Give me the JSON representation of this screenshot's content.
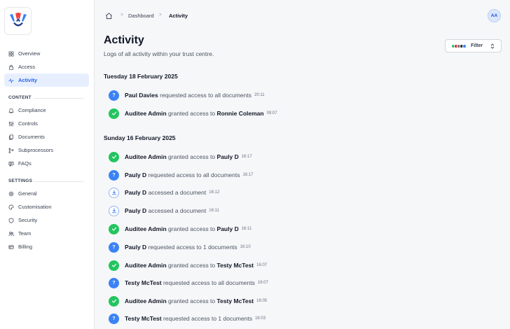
{
  "app": {
    "avatar_initials": "AA"
  },
  "breadcrumb": {
    "items": [
      "Dashboard",
      "Activity"
    ],
    "separator": ">"
  },
  "sidebar": {
    "top_items": [
      {
        "label": "Overview",
        "icon": "grid-icon",
        "active": false
      },
      {
        "label": "Access",
        "icon": "lock-icon",
        "active": false
      },
      {
        "label": "Activity",
        "icon": "pulse-icon",
        "active": true
      }
    ],
    "content_label": "CONTENT",
    "content_items": [
      {
        "label": "Compliance",
        "icon": "bell-icon"
      },
      {
        "label": "Controls",
        "icon": "sliders-icon"
      },
      {
        "label": "Documents",
        "icon": "documents-icon"
      },
      {
        "label": "Subprocessors",
        "icon": "branch-icon"
      },
      {
        "label": "FAQs",
        "icon": "chat-icon"
      }
    ],
    "settings_label": "SETTINGS",
    "settings_items": [
      {
        "label": "General",
        "icon": "gear-icon"
      },
      {
        "label": "Customisation",
        "icon": "palette-icon"
      },
      {
        "label": "Security",
        "icon": "shield-icon"
      },
      {
        "label": "Team",
        "icon": "team-icon"
      },
      {
        "label": "Billing",
        "icon": "card-icon"
      }
    ]
  },
  "page": {
    "title": "Activity",
    "subtitle": "Logs of all activity within your trust centre.",
    "filter_label": "Filter",
    "filter_colors": [
      "#22c55e",
      "#dc2626",
      "#6b7280",
      "#1f2937",
      "#3b82f6"
    ]
  },
  "groups": [
    {
      "date": "Tuesday 18 February 2025",
      "events": [
        {
          "type": "request",
          "actor": "Paul Davies",
          "action": "requested access to all documents",
          "target": "",
          "time": "20:11"
        },
        {
          "type": "grant",
          "actor": "Auditee Admin",
          "action": "granted access to",
          "target": "Ronnie Coleman",
          "time": "09:07"
        }
      ]
    },
    {
      "date": "Sunday 16 February 2025",
      "events": [
        {
          "type": "grant",
          "actor": "Auditee Admin",
          "action": "granted access to",
          "target": "Pauly D",
          "time": "16:17"
        },
        {
          "type": "request",
          "actor": "Pauly D",
          "action": "requested access to all documents",
          "target": "",
          "time": "16:17"
        },
        {
          "type": "document",
          "actor": "Pauly D",
          "action": "accessed a document",
          "target": "",
          "time": "16:12"
        },
        {
          "type": "document",
          "actor": "Pauly D",
          "action": "accessed a document",
          "target": "",
          "time": "16:11"
        },
        {
          "type": "grant",
          "actor": "Auditee Admin",
          "action": "granted access to",
          "target": "Pauly D",
          "time": "16:11"
        },
        {
          "type": "request",
          "actor": "Pauly D",
          "action": "requested access to 1 documents",
          "target": "",
          "time": "16:10"
        },
        {
          "type": "grant",
          "actor": "Auditee Admin",
          "action": "granted access to",
          "target": "Testy McTest",
          "time": "16:07"
        },
        {
          "type": "request",
          "actor": "Testy McTest",
          "action": "requested access to all documents",
          "target": "",
          "time": "16:07"
        },
        {
          "type": "grant",
          "actor": "Auditee Admin",
          "action": "granted access to",
          "target": "Testy McTest",
          "time": "16:05"
        },
        {
          "type": "request",
          "actor": "Testy McTest",
          "action": "requested access to 1 documents",
          "target": "",
          "time": "16:03"
        }
      ]
    }
  ]
}
